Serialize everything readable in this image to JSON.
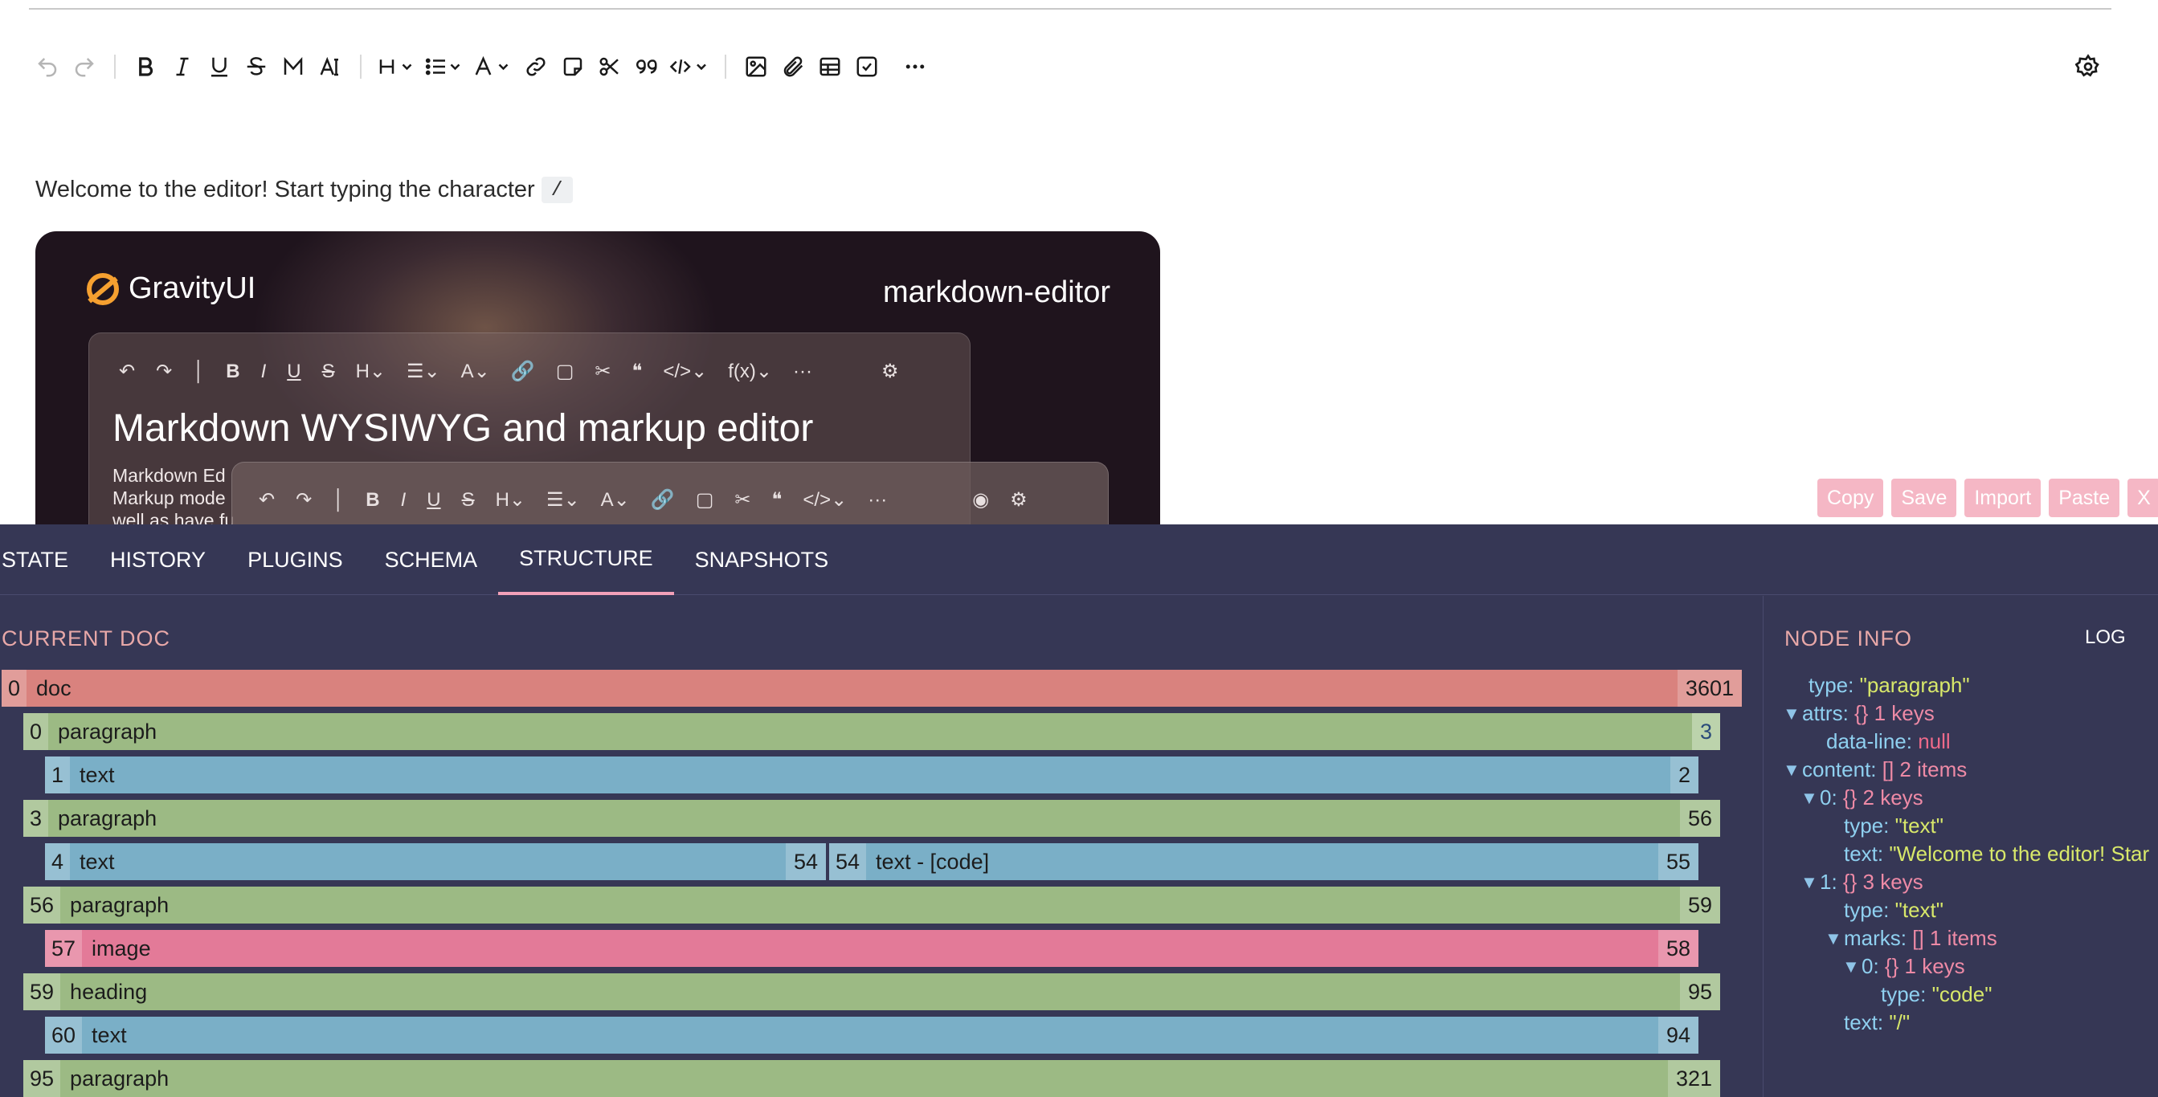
{
  "toolbar": {
    "items": [
      "undo-icon",
      "redo-icon",
      "bold-icon",
      "italic-icon",
      "underline-icon",
      "strikethrough-icon",
      "mark-icon",
      "text-color-icon",
      "heading-icon",
      "list-icon",
      "font-icon",
      "link-icon",
      "note-icon",
      "cut-icon",
      "quote-icon",
      "code-icon",
      "image-icon",
      "attachment-icon",
      "table-icon",
      "checkbox-icon",
      "more-icon",
      "settings-icon"
    ]
  },
  "content": {
    "welcome_text": "Welcome to the editor! Start typing the character",
    "inline_code": "/"
  },
  "banner": {
    "logo_text": "GravityUI",
    "product": "markdown-editor",
    "title": "Markdown WYSIWYG and markup editor",
    "text_lines": [
      "Markdown Ed",
      "Markup mode",
      "well as have fu"
    ]
  },
  "dev_actions": [
    "Copy",
    "Save",
    "Import",
    "Paste",
    "X"
  ],
  "dev_tabs": [
    "STATE",
    "HISTORY",
    "PLUGINS",
    "SCHEMA",
    "STRUCTURE",
    "SNAPSHOTS"
  ],
  "active_tab": "STRUCTURE",
  "doc_pane": {
    "title": "CURRENT DOC",
    "rows": [
      {
        "start": "0",
        "name": "doc",
        "end": "3601"
      },
      {
        "start": "0",
        "name": "paragraph",
        "end": "3"
      },
      {
        "start": "1",
        "name": "text",
        "end": "2"
      },
      {
        "start": "3",
        "name": "paragraph",
        "end": "56"
      },
      {
        "start": "4",
        "name": "text",
        "end": "54"
      },
      {
        "start": "54",
        "name": "text - [code]",
        "end": "55"
      },
      {
        "start": "56",
        "name": "paragraph",
        "end": "59"
      },
      {
        "start": "57",
        "name": "image",
        "end": "58"
      },
      {
        "start": "59",
        "name": "heading",
        "end": "95"
      },
      {
        "start": "60",
        "name": "text",
        "end": "94"
      },
      {
        "start": "95",
        "name": "paragraph",
        "end": "321"
      }
    ]
  },
  "info_pane": {
    "title": "NODE INFO",
    "log_label": "LOG",
    "tree": {
      "type_key": "type:",
      "type_val": "\"paragraph\"",
      "attrs_key": "attrs:",
      "attrs_meta": "{} 1 keys",
      "dataline_key": "data-line:",
      "dataline_val": "null",
      "content_key": "content:",
      "content_meta": "[] 2 items",
      "c0_key": "0:",
      "c0_meta": "{} 2 keys",
      "c0_type_key": "type:",
      "c0_type_val": "\"text\"",
      "c0_text_key": "text:",
      "c0_text_val": "\"Welcome to the editor! Star",
      "c1_key": "1:",
      "c1_meta": "{} 3 keys",
      "c1_type_key": "type:",
      "c1_type_val": "\"text\"",
      "marks_key": "marks:",
      "marks_meta": "[] 1 items",
      "m0_key": "0:",
      "m0_meta": "{} 1 keys",
      "m0_type_key": "type:",
      "m0_type_val": "\"code\"",
      "c1_text_key": "text:",
      "c1_text_val": "\"/\""
    }
  },
  "colors": {
    "devtools_bg": "#363755",
    "doc": "#d9827e",
    "paragraph": "#9cba84",
    "text": "#7aafc7",
    "image": "#e37a98",
    "heading": "#9cba84",
    "tab_underline": "#f2a0b8",
    "action_button": "#f5b7c5"
  }
}
